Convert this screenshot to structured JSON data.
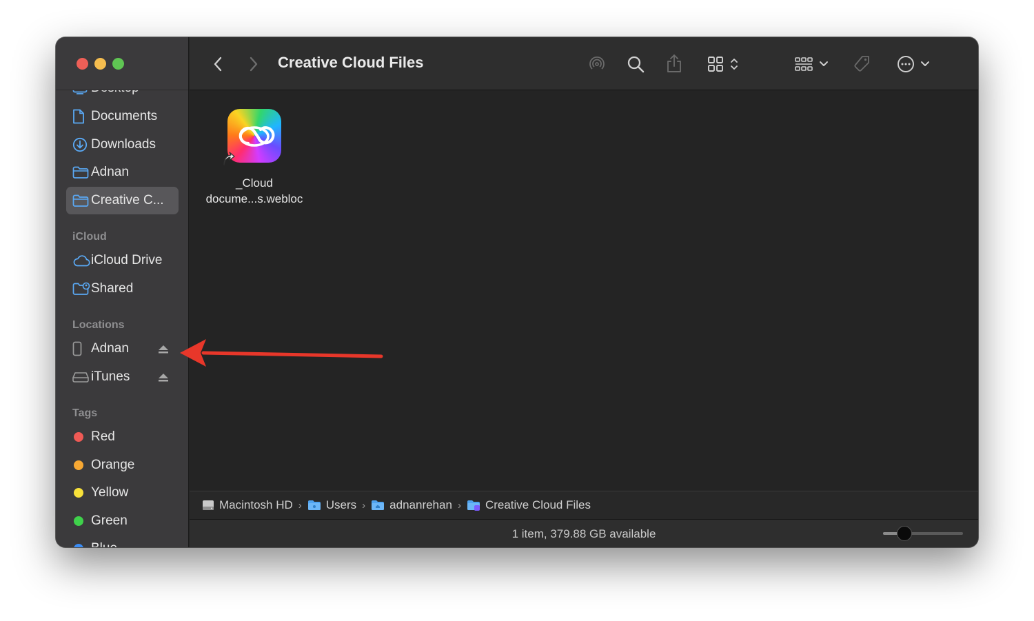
{
  "window": {
    "title": "Creative Cloud Files"
  },
  "sidebar": {
    "favorites": [
      {
        "label": "Desktop",
        "icon": "desktop-icon"
      },
      {
        "label": "Documents",
        "icon": "document-icon"
      },
      {
        "label": "Downloads",
        "icon": "download-icon"
      },
      {
        "label": "Adnan",
        "icon": "folder-icon"
      },
      {
        "label": "Creative C...",
        "icon": "folder-icon",
        "selected": true
      }
    ],
    "icloud_header": "iCloud",
    "icloud": [
      {
        "label": "iCloud Drive",
        "icon": "cloud-icon"
      },
      {
        "label": "Shared",
        "icon": "shared-folder-icon"
      }
    ],
    "locations_header": "Locations",
    "locations": [
      {
        "label": "Adnan",
        "icon": "iphone-icon",
        "ejectable": true
      },
      {
        "label": "iTunes",
        "icon": "drive-icon",
        "ejectable": true
      }
    ],
    "tags_header": "Tags",
    "tags": [
      {
        "label": "Red",
        "color": "#ef5a55"
      },
      {
        "label": "Orange",
        "color": "#f7a833"
      },
      {
        "label": "Yellow",
        "color": "#f8e13a"
      },
      {
        "label": "Green",
        "color": "#3fd14b"
      },
      {
        "label": "Blue",
        "color": "#3a8cf5"
      }
    ]
  },
  "content": {
    "files": [
      {
        "name_line1": "_Cloud",
        "name_line2": "docume...s.webloc",
        "icon": "creative-cloud-icon"
      }
    ]
  },
  "pathbar": {
    "crumbs": [
      {
        "label": "Macintosh HD",
        "icon": "hard-drive-icon"
      },
      {
        "label": "Users",
        "icon": "folder-icon"
      },
      {
        "label": "adnanrehan",
        "icon": "home-folder-icon"
      },
      {
        "label": "Creative Cloud Files",
        "icon": "cc-folder-icon"
      }
    ],
    "separator": "›"
  },
  "status": {
    "text": "1 item, 379.88 GB available",
    "icon_size_level": 0.27
  },
  "colors": {
    "annotation_arrow": "#e8372a",
    "accent": "#5aa9f5"
  }
}
